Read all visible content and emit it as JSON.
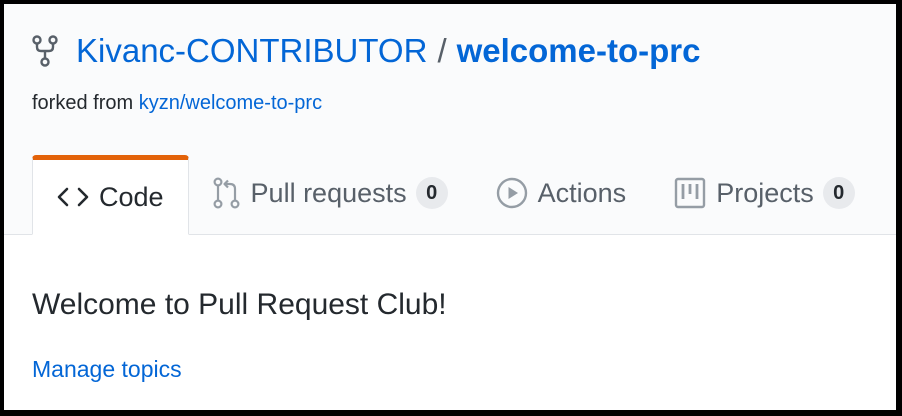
{
  "repo": {
    "owner": "Kivanc-CONTRIBUTOR",
    "separator": "/",
    "name": "welcome-to-prc",
    "forked_prefix": "forked from ",
    "forked_source": "kyzn/welcome-to-prc"
  },
  "tabs": [
    {
      "label": "Code",
      "icon": "code-icon",
      "active": true
    },
    {
      "label": "Pull requests",
      "icon": "pull-request-icon",
      "count": "0"
    },
    {
      "label": "Actions",
      "icon": "play-icon"
    },
    {
      "label": "Projects",
      "icon": "project-icon",
      "count": "0"
    }
  ],
  "about": {
    "description": "Welcome to Pull Request Club!",
    "manage_topics": "Manage topics"
  },
  "colors": {
    "link": "#0366d6",
    "active_tab_accent": "#e36209",
    "text": "#24292e",
    "muted": "#586069"
  }
}
